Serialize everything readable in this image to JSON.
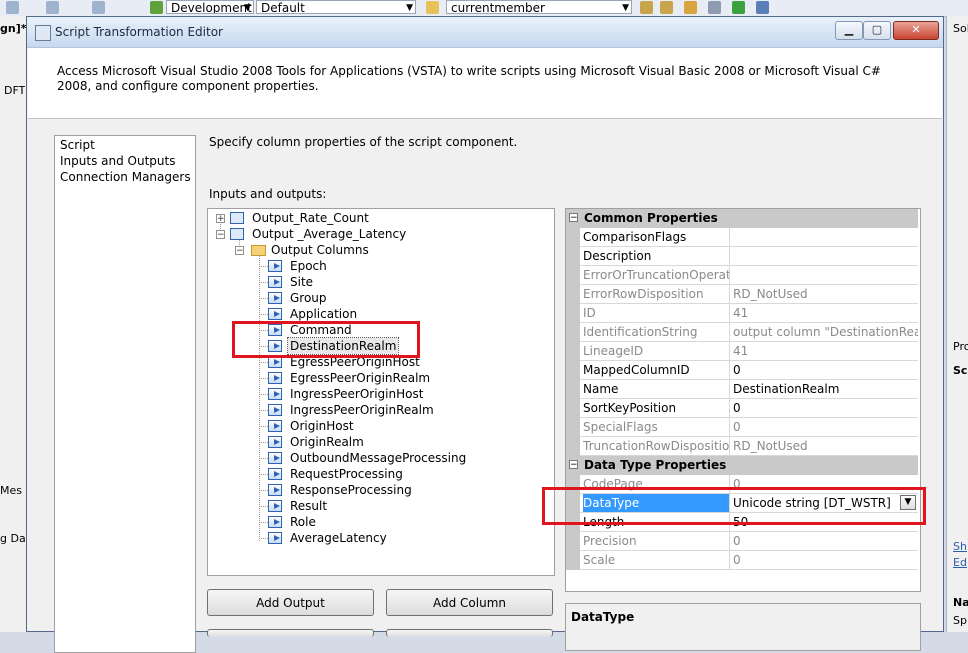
{
  "ide": {
    "toolbar": {
      "configuration": "Development",
      "platform": "Default",
      "member": "currentmember"
    },
    "left_fragments": [
      "gn]*",
      "DFT",
      "Mes",
      "g Da"
    ],
    "right_fragments": [
      "Sol",
      "Pro",
      "Scr",
      "Sh",
      "Ed",
      "Na",
      "Sp"
    ]
  },
  "dialog": {
    "title": "Script Transformation Editor",
    "description": "Access Microsoft Visual Studio 2008 Tools for Applications (VSTA) to write scripts using Microsoft Visual Basic 2008 or Microsoft Visual C# 2008, and configure component properties.",
    "nav": [
      "Script",
      "Inputs and Outputs",
      "Connection Managers"
    ],
    "selected_nav": "Inputs and Outputs",
    "instruction": "Specify column properties of the script component.",
    "tree_label": "Inputs and outputs:",
    "tree": {
      "output1": "Output_Rate_Count",
      "output2": "Output _Average_Latency",
      "folder": "Output Columns",
      "columns": [
        "Epoch",
        "Site",
        "Group",
        "Application",
        "Command",
        "DestinationRealm",
        "EgressPeerOriginHost",
        "EgressPeerOriginRealm",
        "IngressPeerOriginHost",
        "IngressPeerOriginRealm",
        "OriginHost",
        "OriginRealm",
        "OutboundMessageProcessing",
        "RequestProcessing",
        "ResponseProcessing",
        "Result",
        "Role",
        "AverageLatency"
      ],
      "selected_column": "DestinationRealm"
    },
    "properties": {
      "common_category": "Common Properties",
      "common": [
        {
          "name": "ComparisonFlags",
          "value": "",
          "readonly": false
        },
        {
          "name": "Description",
          "value": "",
          "readonly": false
        },
        {
          "name": "ErrorOrTruncationOperation",
          "value": "",
          "readonly": true
        },
        {
          "name": "ErrorRowDisposition",
          "value": "RD_NotUsed",
          "readonly": true
        },
        {
          "name": "ID",
          "value": "41",
          "readonly": true
        },
        {
          "name": "IdentificationString",
          "value": "output column \"DestinationRealm\"",
          "readonly": true
        },
        {
          "name": "LineageID",
          "value": "41",
          "readonly": true
        },
        {
          "name": "MappedColumnID",
          "value": "0",
          "readonly": false
        },
        {
          "name": "Name",
          "value": "DestinationRealm",
          "readonly": false
        },
        {
          "name": "SortKeyPosition",
          "value": "0",
          "readonly": false
        },
        {
          "name": "SpecialFlags",
          "value": "0",
          "readonly": true
        },
        {
          "name": "TruncationRowDisposition",
          "value": "RD_NotUsed",
          "readonly": true
        }
      ],
      "datatype_category": "Data Type Properties",
      "datatype": [
        {
          "name": "CodePage",
          "value": "0",
          "readonly": true
        },
        {
          "name": "DataType",
          "value": "Unicode string [DT_WSTR]",
          "readonly": false
        },
        {
          "name": "Length",
          "value": "50",
          "readonly": false
        },
        {
          "name": "Precision",
          "value": "0",
          "readonly": true
        },
        {
          "name": "Scale",
          "value": "0",
          "readonly": true
        }
      ],
      "selected": "DataType"
    },
    "description_title": "DataType",
    "buttons": {
      "add_output": "Add Output",
      "add_column": "Add Column"
    }
  },
  "colors": {
    "highlight": "#e0141e",
    "selection": "#3399ff"
  }
}
